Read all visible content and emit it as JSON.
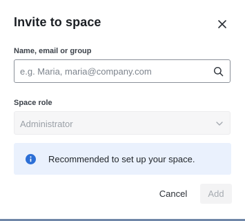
{
  "dialog": {
    "title": "Invite to space",
    "close_icon": "close-icon"
  },
  "fields": {
    "name": {
      "label": "Name, email or group",
      "value": "",
      "placeholder": "e.g. Maria, maria@company.com",
      "icon": "search-icon"
    },
    "role": {
      "label": "Space role",
      "selected": "Administrator",
      "disabled": true,
      "icon": "chevron-down-icon"
    }
  },
  "info": {
    "icon": "info-icon",
    "message": "Recommended to set up your space."
  },
  "actions": {
    "cancel_label": "Cancel",
    "add_label": "Add",
    "add_disabled": true
  },
  "colors": {
    "info_background": "#eaf1fd",
    "info_icon": "#2c6fd6",
    "accent_bar": "#6f86a8"
  }
}
